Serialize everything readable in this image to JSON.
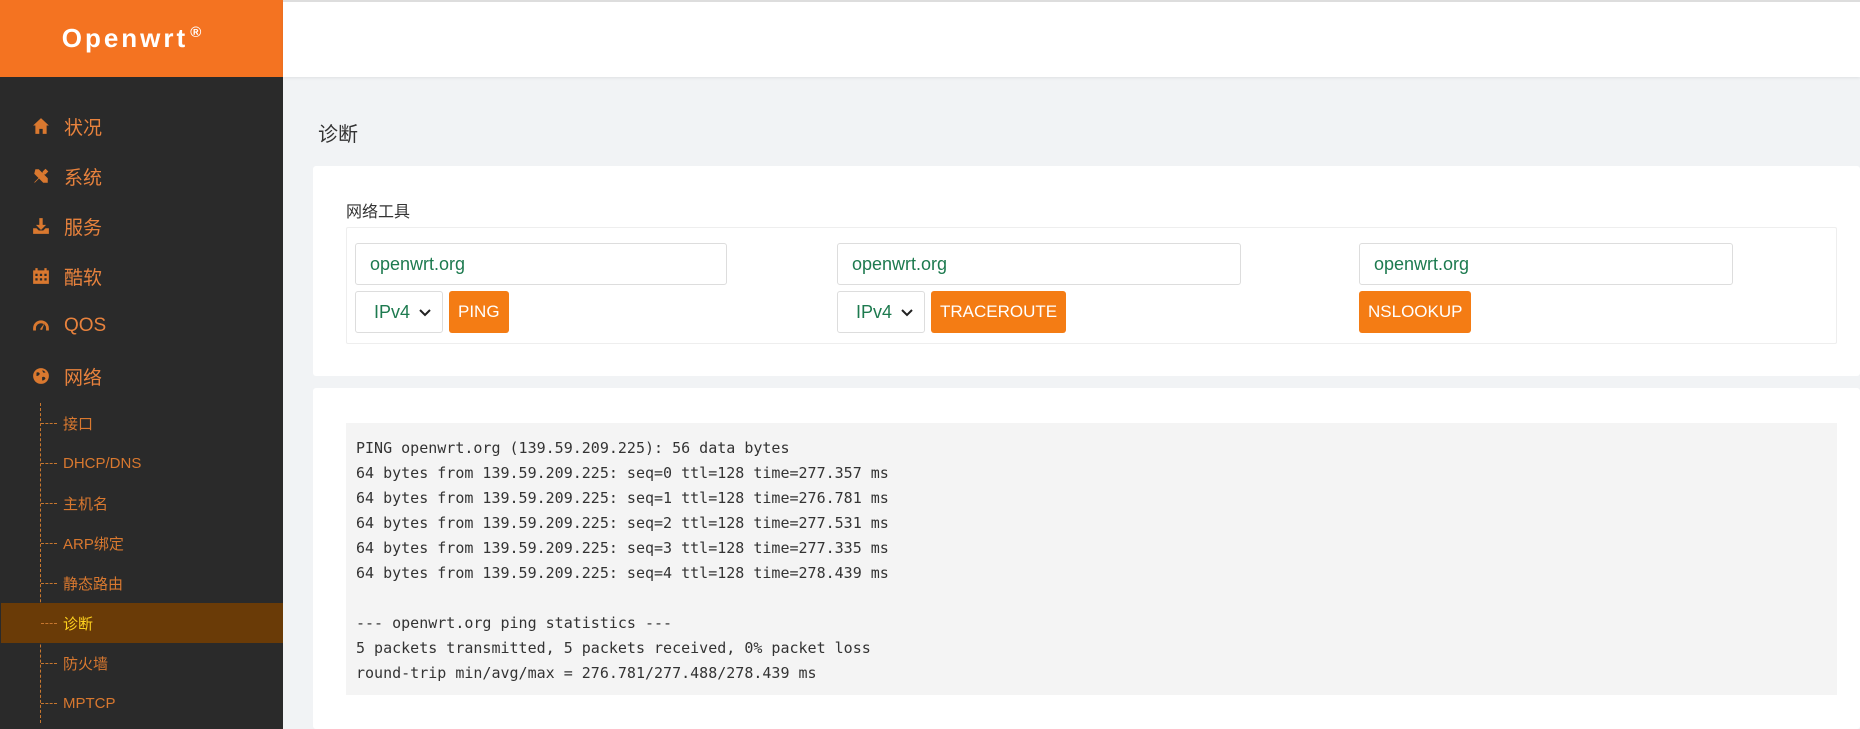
{
  "brand": {
    "name": "Openwrt",
    "reg": "®"
  },
  "sidebar": {
    "items": [
      {
        "label": "状况",
        "icon": "home-icon"
      },
      {
        "label": "系统",
        "icon": "tools-icon"
      },
      {
        "label": "服务",
        "icon": "download-icon"
      },
      {
        "label": "酷软",
        "icon": "calendar-icon"
      },
      {
        "label": "QOS",
        "icon": "gauge-icon"
      },
      {
        "label": "网络",
        "icon": "globe-icon"
      }
    ],
    "network_sub": [
      {
        "label": "接口"
      },
      {
        "label": "DHCP/DNS"
      },
      {
        "label": "主机名"
      },
      {
        "label": "ARP绑定"
      },
      {
        "label": "静态路由"
      },
      {
        "label": "诊断",
        "active": true
      },
      {
        "label": "防火墙"
      },
      {
        "label": "MPTCP"
      }
    ]
  },
  "page": {
    "title": "诊断"
  },
  "tools": {
    "section_title": "网络工具",
    "ping": {
      "value": "openwrt.org",
      "protocol": "IPv4",
      "button": "PING"
    },
    "traceroute": {
      "value": "openwrt.org",
      "protocol": "IPv4",
      "button": "TRACEROUTE"
    },
    "nslookup": {
      "value": "openwrt.org",
      "button": "NSLOOKUP"
    }
  },
  "output": {
    "lines": [
      "PING openwrt.org (139.59.209.225): 56 data bytes",
      "64 bytes from 139.59.209.225: seq=0 ttl=128 time=277.357 ms",
      "64 bytes from 139.59.209.225: seq=1 ttl=128 time=276.781 ms",
      "64 bytes from 139.59.209.225: seq=2 ttl=128 time=277.531 ms",
      "64 bytes from 139.59.209.225: seq=3 ttl=128 time=277.335 ms",
      "64 bytes from 139.59.209.225: seq=4 ttl=128 time=278.439 ms",
      "",
      "--- openwrt.org ping statistics ---",
      "5 packets transmitted, 5 packets received, 0% packet loss",
      "round-trip min/avg/max = 276.781/277.488/278.439 ms"
    ]
  },
  "colors": {
    "brand": "#f47321",
    "sidebar_bg": "#2a2a2a",
    "menu_text": "#e8823d",
    "active_bg": "#6a3b07",
    "active_text": "#ffd21e",
    "button": "#f47c14",
    "input_text": "#1d7a4f"
  }
}
